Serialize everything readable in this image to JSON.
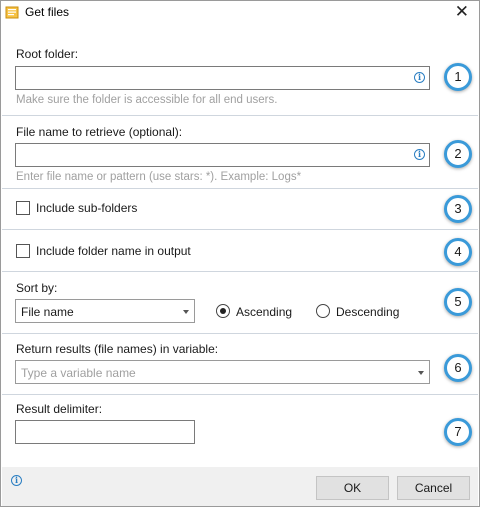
{
  "window": {
    "title": "Get files",
    "close_glyph": "✕"
  },
  "sections": {
    "root_folder": {
      "label": "Root folder:",
      "value": "",
      "hint": "Make sure the folder is accessible for all end users.",
      "badge": "1"
    },
    "file_name": {
      "label": "File name to retrieve (optional):",
      "value": "",
      "hint": "Enter file name or pattern (use stars: *).  Example: Logs*",
      "badge": "2"
    },
    "subfolders": {
      "label": "Include sub-folders",
      "checked": false,
      "badge": "3"
    },
    "folder_name": {
      "label": "Include folder name in output",
      "checked": false,
      "badge": "4"
    },
    "sort": {
      "label": "Sort by:",
      "selected": "File name",
      "ascending_label": "Ascending",
      "descending_label": "Descending",
      "order": "ascending",
      "badge": "5"
    },
    "variable": {
      "label": "Return results (file names) in variable:",
      "placeholder": "Type a variable name",
      "badge": "6"
    },
    "delimiter": {
      "label": "Result delimiter:",
      "value": "",
      "badge": "7"
    }
  },
  "footer": {
    "ok_label": "OK",
    "cancel_label": "Cancel"
  },
  "icons": {
    "info": "info-icon",
    "app": "app-icon",
    "close": "close-icon"
  },
  "colors": {
    "accent": "#3a9ad9",
    "info": "#2a7ec2",
    "hint": "#a0a0a0",
    "divider": "#cfd6de",
    "footer_bg": "#f0f0f0"
  }
}
